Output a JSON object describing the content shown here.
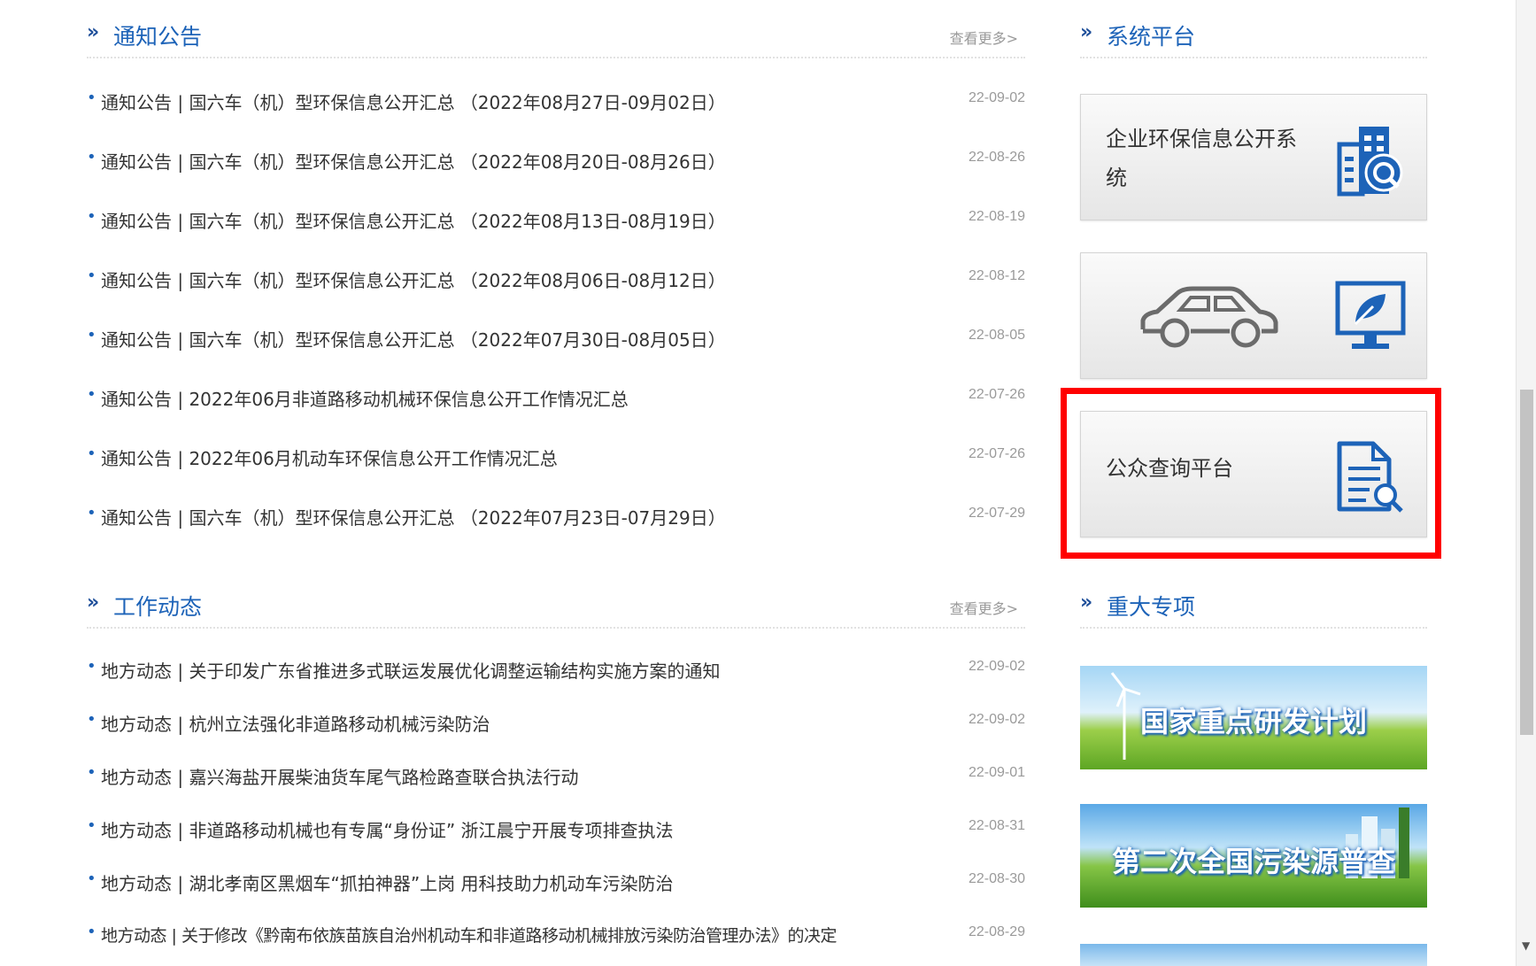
{
  "notices": {
    "chevron": "»",
    "title": "通知公告",
    "more": "查看更多>",
    "items": [
      {
        "text": "通知公告 | 国六车（机）型环保信息公开汇总 （2022年08月27日-09月02日）",
        "date": "22-09-02"
      },
      {
        "text": "通知公告 | 国六车（机）型环保信息公开汇总 （2022年08月20日-08月26日）",
        "date": "22-08-26"
      },
      {
        "text": "通知公告 | 国六车（机）型环保信息公开汇总 （2022年08月13日-08月19日）",
        "date": "22-08-19"
      },
      {
        "text": "通知公告 | 国六车（机）型环保信息公开汇总 （2022年08月06日-08月12日）",
        "date": "22-08-12"
      },
      {
        "text": "通知公告 | 国六车（机）型环保信息公开汇总 （2022年07月30日-08月05日）",
        "date": "22-08-05"
      },
      {
        "text": "通知公告 | 2022年06月非道路移动机械环保信息公开工作情况汇总",
        "date": "22-07-26"
      },
      {
        "text": "通知公告 | 2022年06月机动车环保信息公开工作情况汇总",
        "date": "22-07-26"
      },
      {
        "text": "通知公告 | 国六车（机）型环保信息公开汇总 （2022年07月23日-07月29日）",
        "date": "22-07-29"
      }
    ]
  },
  "work": {
    "chevron": "»",
    "title": "工作动态",
    "more": "查看更多>",
    "items": [
      {
        "text": "地方动态 | 关于印发广东省推进多式联运发展优化调整运输结构实施方案的通知",
        "date": "22-09-02"
      },
      {
        "text": "地方动态 | 杭州立法强化非道路移动机械污染防治",
        "date": "22-09-02"
      },
      {
        "text": "地方动态 | 嘉兴海盐开展柴油货车尾气路检路查联合执法行动",
        "date": "22-09-01"
      },
      {
        "text": "地方动态 | 非道路移动机械也有专属“身份证” 浙江晨宁开展专项排查执法",
        "date": "22-08-31"
      },
      {
        "text": "地方动态 | 湖北孝南区黑烟车“抓拍神器”上岗 用科技助力机动车污染防治",
        "date": "22-08-30"
      },
      {
        "text": "地方动态 | 关于修改《黔南布依族苗族自治州机动车和非道路移动机械排放污染防治管理办法》的决定",
        "date": "22-08-29"
      }
    ]
  },
  "platform": {
    "chevron": "»",
    "title": "系统平台",
    "cards": [
      {
        "label": "企业环保信息公开系统",
        "icon": "building-search-icon"
      },
      {
        "label": "",
        "icon": "car-icon"
      },
      {
        "label": "公众查询平台",
        "icon": "document-search-icon"
      }
    ]
  },
  "projects": {
    "chevron": "»",
    "title": "重大专项",
    "banners": [
      {
        "text": "国家重点研发计划"
      },
      {
        "text": "第二次全国污染源普查"
      }
    ]
  },
  "colors": {
    "accent": "#1d63b8",
    "highlight": "#ff0000",
    "date_gray": "#9a9a9a"
  }
}
